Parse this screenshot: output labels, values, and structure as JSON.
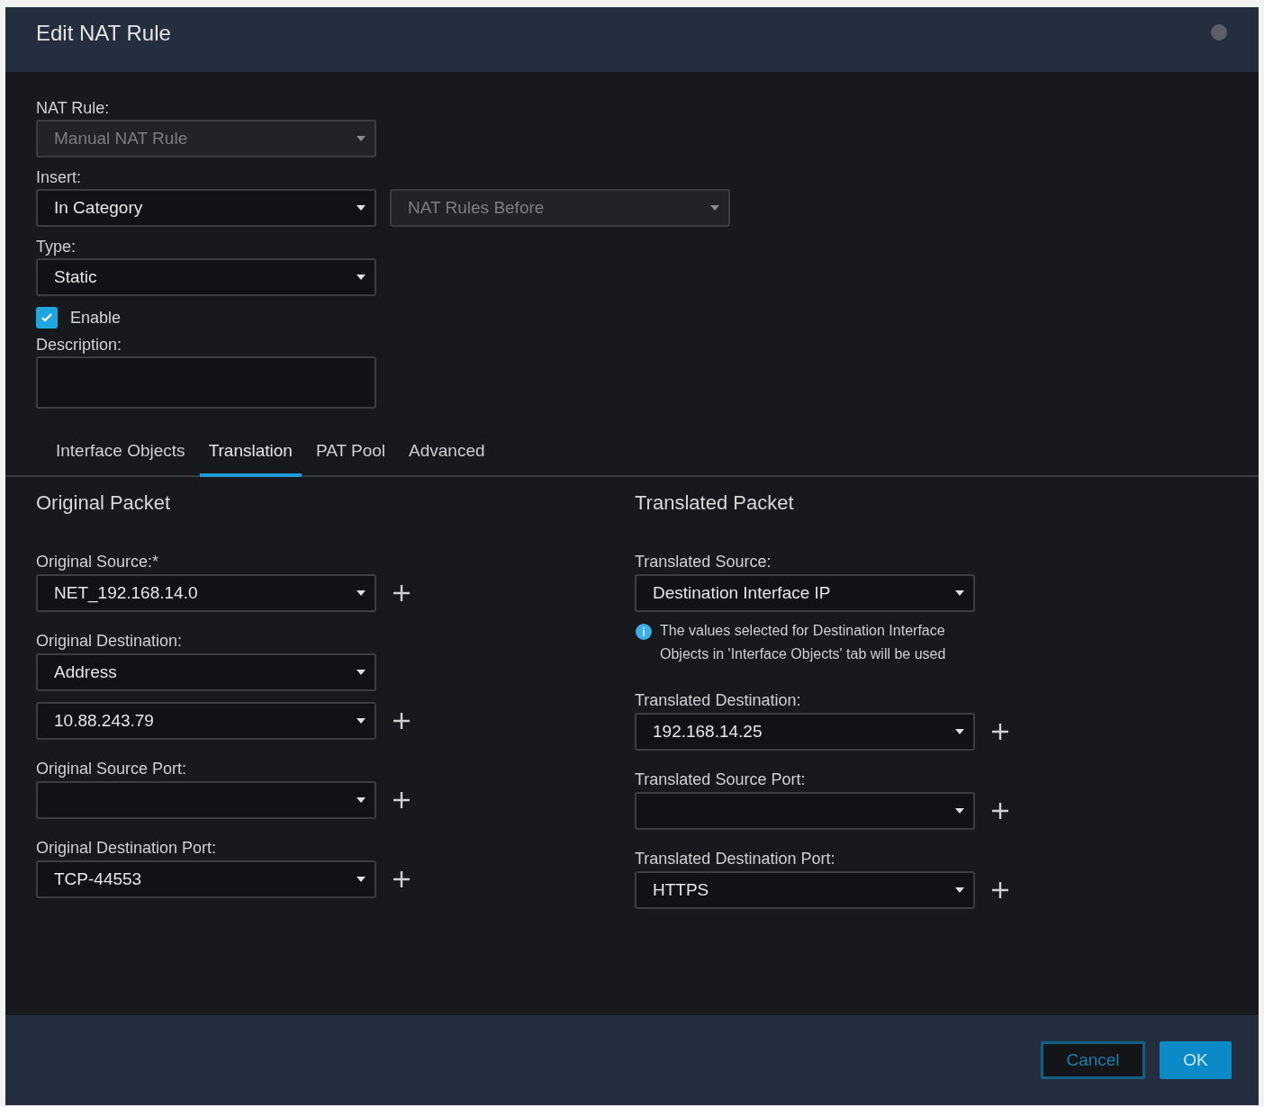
{
  "window": {
    "title": "Edit NAT Rule"
  },
  "nat_rule": {
    "label": "NAT Rule:",
    "value": "Manual NAT Rule",
    "disabled": true
  },
  "insert": {
    "label": "Insert:",
    "selects": [
      {
        "value": "In Category",
        "disabled": false
      },
      {
        "value": "NAT Rules Before",
        "disabled": true
      }
    ]
  },
  "type": {
    "label": "Type:",
    "value": "Static",
    "disabled": false
  },
  "enable": {
    "label": "Enable",
    "checked": true
  },
  "description": {
    "label": "Description:"
  },
  "tabs": [
    {
      "label": "Interface Objects",
      "selected": false
    },
    {
      "label": "Translation",
      "selected": true
    },
    {
      "label": "PAT Pool",
      "selected": false
    },
    {
      "label": "Advanced",
      "selected": false
    }
  ],
  "original_packet": {
    "title": "Original Packet",
    "fields": [
      {
        "label": "Original Source:*",
        "selects": [
          {
            "value": "NET_192.168.14.0",
            "add_button": true
          }
        ]
      },
      {
        "label": "Original Destination:",
        "selects": [
          {
            "value": "Address",
            "add_button": false
          },
          {
            "value": "10.88.243.79",
            "add_button": true
          }
        ]
      },
      {
        "label": "Original Source Port:",
        "selects": [
          {
            "add_button": true
          }
        ]
      },
      {
        "label": "Original Destination Port:",
        "selects": [
          {
            "value": "TCP-44553",
            "add_button": true
          }
        ]
      }
    ]
  },
  "translated_packet": {
    "title": "Translated Packet",
    "fields": [
      {
        "label": "Translated Source:",
        "selects": [
          {
            "value": "Destination Interface IP",
            "add_button": false
          }
        ],
        "info": "The values selected for Destination Interface Objects in 'Interface Objects' tab will be used"
      },
      {
        "label": "Translated Destination:",
        "selects": [
          {
            "value": "192.168.14.25",
            "add_button": true
          }
        ]
      },
      {
        "label": "Translated Source Port:",
        "selects": [
          {
            "add_button": true
          }
        ]
      },
      {
        "label": "Translated Destination Port:",
        "selects": [
          {
            "value": "HTTPS",
            "add_button": true
          }
        ]
      }
    ]
  },
  "buttons": [
    {
      "label": "Cancel",
      "kind": "secondary"
    },
    {
      "label": "OK",
      "kind": "primary"
    }
  ]
}
